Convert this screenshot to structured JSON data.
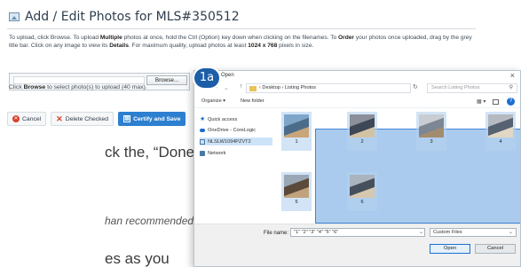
{
  "panel": {
    "title": "Add / Edit Photos for MLS#350512",
    "instructions": [
      {
        "t": "To upload, click Browse. To upload ",
        "b": false
      },
      {
        "t": "Multiple",
        "b": true
      },
      {
        "t": " photos at once, hold the Ctrl (Option) key down when clicking on the filenames. To ",
        "b": false
      },
      {
        "t": "Order",
        "b": true
      },
      {
        "t": " your photos once uploaded, drag by the grey title bar. Click on any image to view its ",
        "b": false
      },
      {
        "t": "Details",
        "b": true
      },
      {
        "t": ". For maximum quality, upload photos at least ",
        "b": false
      },
      {
        "t": "1024 x 768",
        "b": true
      },
      {
        "t": " pixels in size.",
        "b": false
      }
    ],
    "browse_label": "Browse...",
    "browse_caption_prefix": "Click ",
    "browse_caption_bold": "Browse",
    "browse_caption_suffix": " to select photo(s) to upload (40 max).",
    "actions": {
      "cancel": "Cancel",
      "delete_checked": "Delete Checked",
      "certify_save": "Certify and Save"
    }
  },
  "background_text": {
    "line1": "ck the, “Done”",
    "line2": "han recommended.",
    "line3": "es as you"
  },
  "step_badge": "1a",
  "dialog": {
    "title": "Open",
    "close": "×",
    "address": "‹ Desktop › Listing Photos",
    "search_placeholder": "Search Listing Photos",
    "toolbar": {
      "organize": "Organize ▾",
      "new_folder": "New folder"
    },
    "nav": [
      {
        "label": "Quick access",
        "icon": "star-icon"
      },
      {
        "label": "OneDrive - CoreLogic",
        "icon": "cloud-icon"
      },
      {
        "label": "NLSLW1094PZVT2",
        "icon": "computer-icon",
        "selected": true
      },
      {
        "label": "Network",
        "icon": "network-icon"
      }
    ],
    "files": [
      {
        "label": "1",
        "palette": [
          "#7fa6c9",
          "#4c6d8a",
          "#c9a57a"
        ]
      },
      {
        "label": "2",
        "palette": [
          "#8a8f99",
          "#3d4756",
          "#d2c2a4"
        ]
      },
      {
        "label": "3",
        "palette": [
          "#c9ccd2",
          "#7c8694",
          "#a38c6e"
        ]
      },
      {
        "label": "4",
        "palette": [
          "#b5b9c0",
          "#566171",
          "#e1d7c5"
        ]
      },
      {
        "label": "5",
        "palette": [
          "#9aa8b6",
          "#5b4a3a",
          "#c0a27d"
        ]
      },
      {
        "label": "6",
        "palette": [
          "#aab4bf",
          "#46505d",
          "#d6c8ae"
        ]
      }
    ],
    "filename_label": "File name:",
    "filename_value": "\"1\" \"2\" \"3\" \"4\" \"5\" \"6\"",
    "filter_value": "Custom Files",
    "open_label": "Open",
    "cancel_label": "Cancel"
  },
  "colors": {
    "accent": "#2d7fd0",
    "selection": "#66a0e0",
    "badge": "#1c5ea8",
    "danger": "#d9412b"
  }
}
